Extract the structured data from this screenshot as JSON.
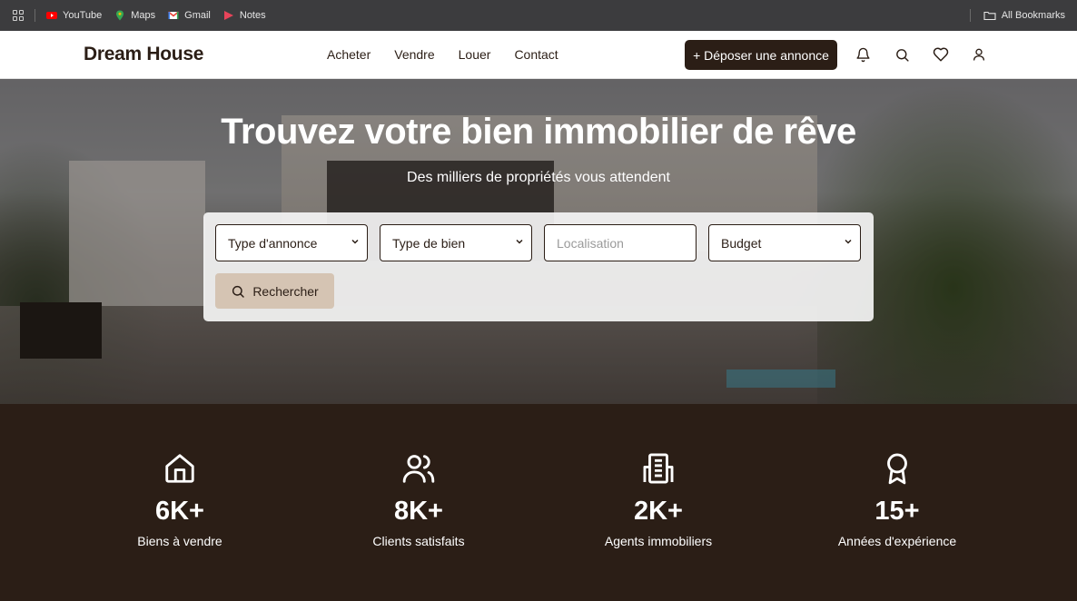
{
  "bookmarks": {
    "items": [
      {
        "label": "YouTube",
        "icon": "youtube-icon",
        "color": "#ff0000"
      },
      {
        "label": "Maps",
        "icon": "maps-icon",
        "color": "#34a853"
      },
      {
        "label": "Gmail",
        "icon": "gmail-icon",
        "color": "#ea4335"
      },
      {
        "label": "Notes",
        "icon": "notes-icon",
        "color": "#e8445a"
      }
    ],
    "all_bookmarks": "All Bookmarks"
  },
  "header": {
    "logo": "Dream House",
    "nav": [
      "Acheter",
      "Vendre",
      "Louer",
      "Contact"
    ],
    "post_button": "+ Déposer une annonce",
    "icons": [
      "bell-icon",
      "search-icon",
      "heart-icon",
      "user-icon"
    ]
  },
  "hero": {
    "title": "Trouvez votre bien immobilier de rêve",
    "subtitle": "Des milliers de propriétés vous attendent",
    "search": {
      "listing_type": "Type d'annonce",
      "property_type": "Type de bien",
      "location_placeholder": "Localisation",
      "budget": "Budget",
      "button": "Rechercher"
    }
  },
  "stats": [
    {
      "icon": "home-icon",
      "value": "6K+",
      "label": "Biens à vendre"
    },
    {
      "icon": "users-icon",
      "value": "8K+",
      "label": "Clients satisfaits"
    },
    {
      "icon": "building-icon",
      "value": "2K+",
      "label": "Agents immobiliers"
    },
    {
      "icon": "award-icon",
      "value": "15+",
      "label": "Années d'expérience"
    }
  ],
  "colors": {
    "brand": "#2b1e16",
    "accent": "#d5c4b3"
  }
}
